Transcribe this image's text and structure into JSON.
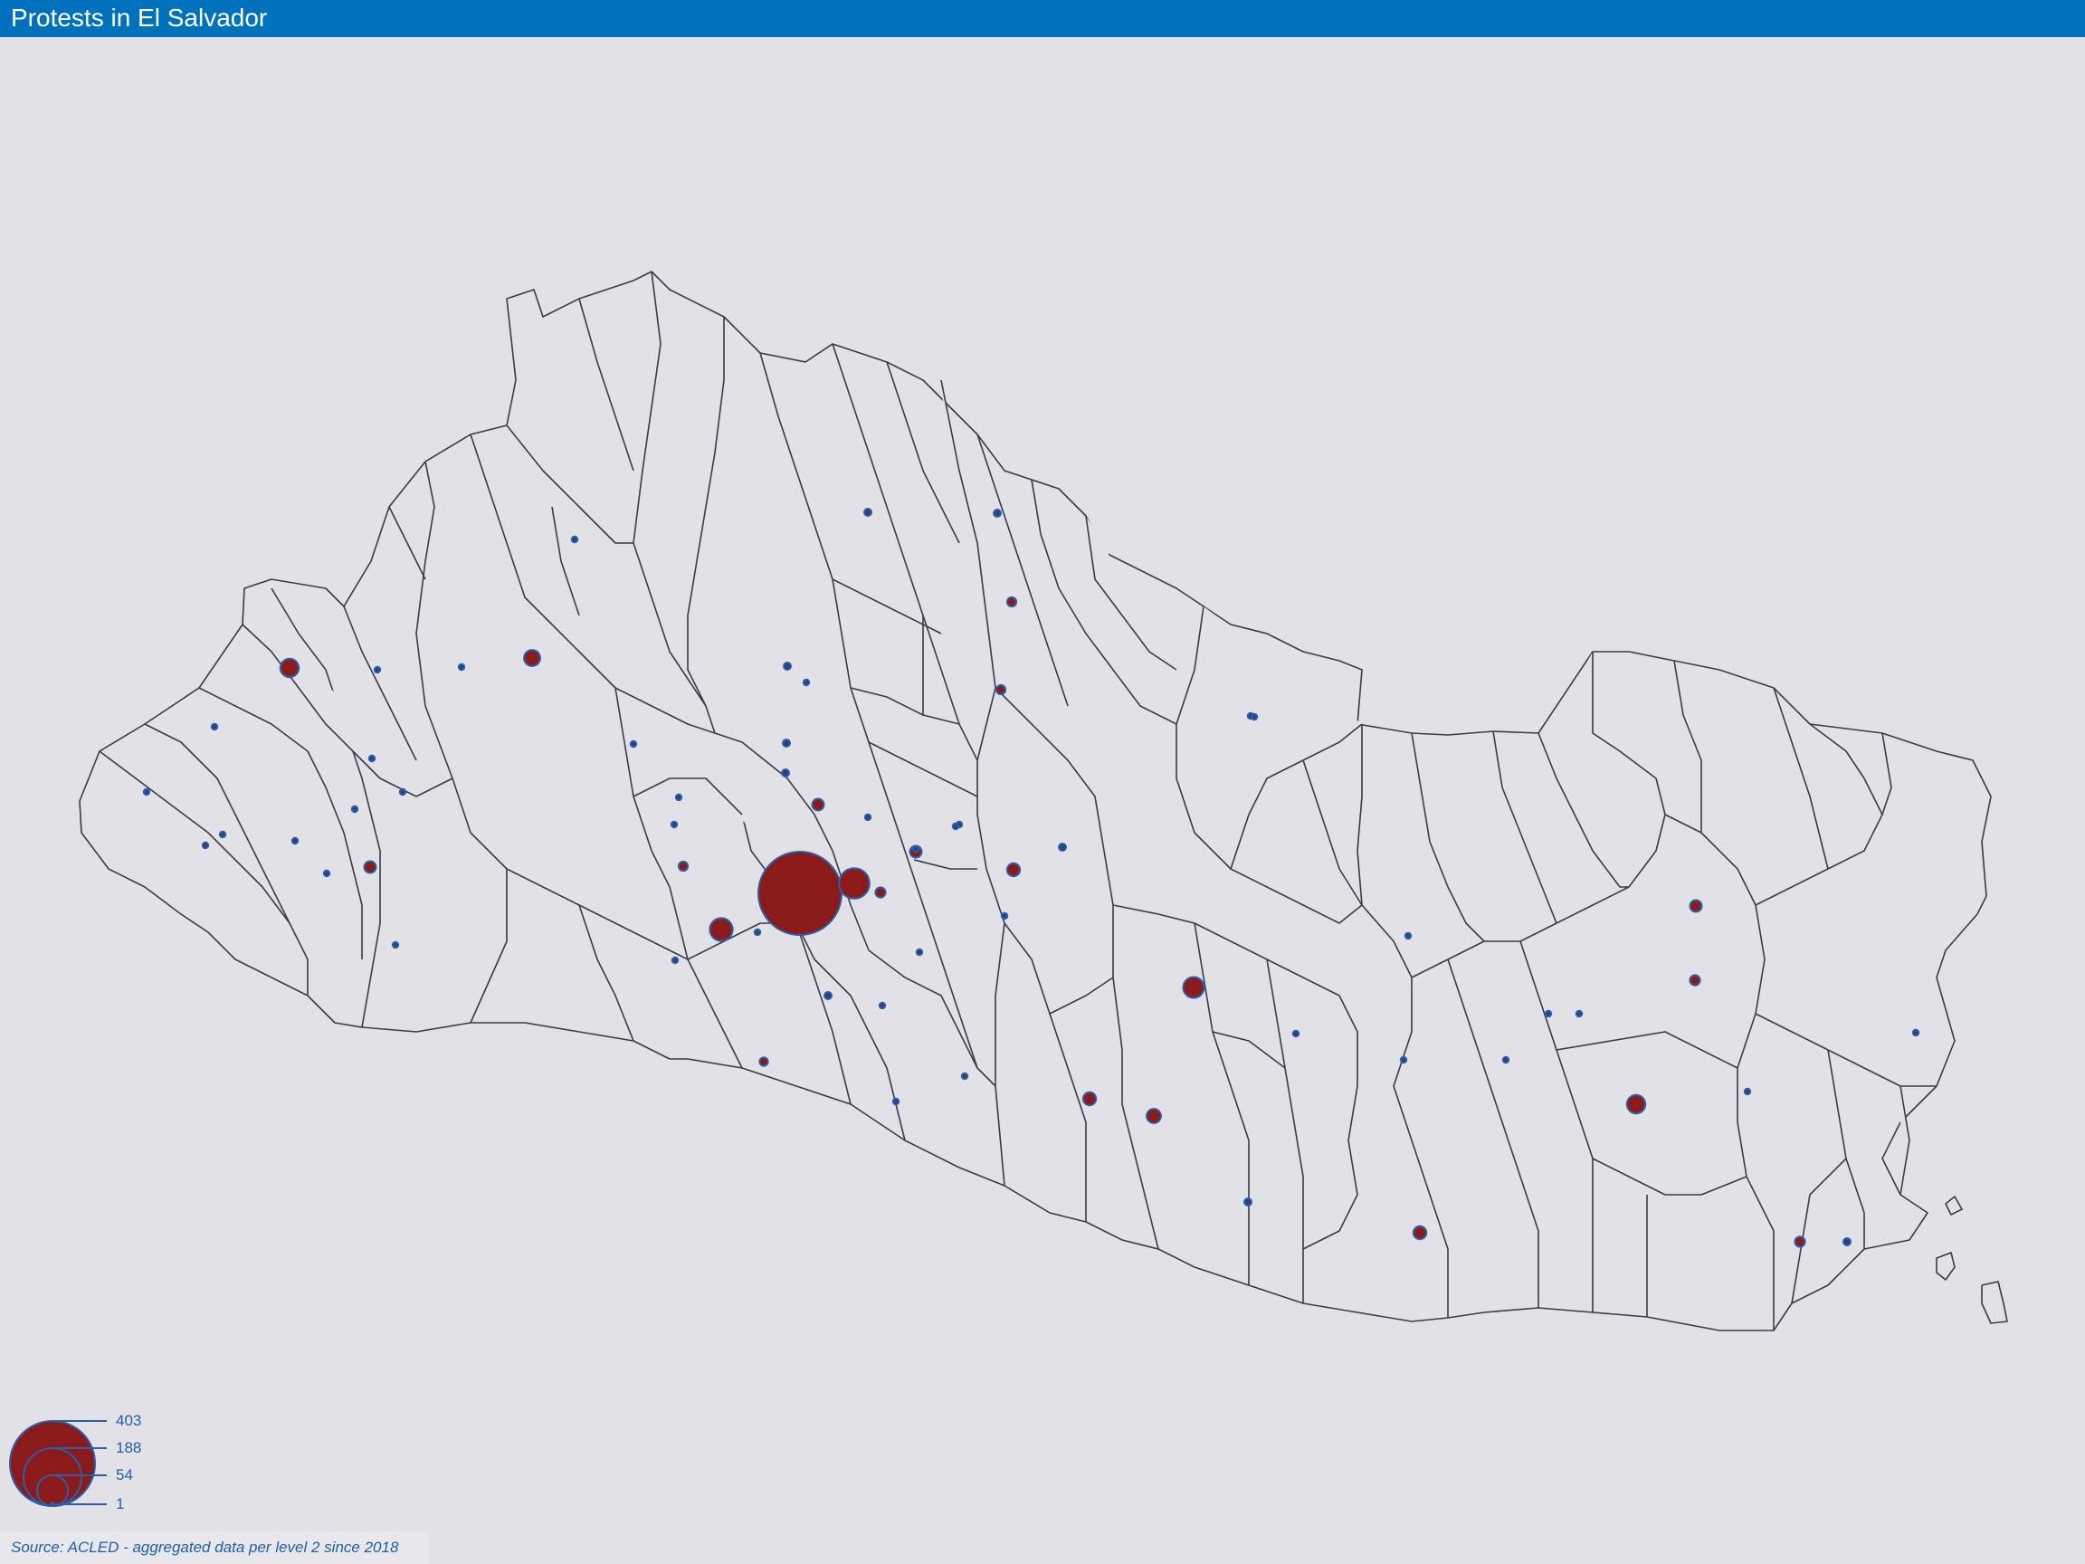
{
  "header": {
    "title": "Protests in El Salvador",
    "bar_color": "#0071bc"
  },
  "map": {
    "background_color": "#e1e1e6",
    "boundary_color": "#3a3a4a",
    "marker_fill": "#8b1a1a",
    "marker_stroke": "#2b5fa8",
    "marker_values": [
      403,
      54,
      30,
      25,
      20,
      20,
      15,
      12,
      10,
      10,
      10,
      8,
      8,
      8,
      8,
      6,
      6,
      6,
      5,
      5,
      5,
      4,
      3,
      3,
      3,
      3,
      3,
      3,
      3,
      3,
      3,
      2,
      2,
      2,
      2,
      2,
      2,
      2,
      2,
      2,
      2,
      2,
      2,
      2,
      2,
      1,
      1,
      1,
      1,
      1,
      1,
      1,
      1,
      1,
      1,
      1,
      1,
      1,
      1,
      1,
      1,
      1,
      1,
      1,
      1,
      1,
      1,
      1,
      1
    ]
  },
  "legend": {
    "labels": [
      "403",
      "188",
      "54",
      "1"
    ]
  },
  "footer": {
    "source": "Source: ACLED - aggregated data per level 2 since 2018"
  }
}
